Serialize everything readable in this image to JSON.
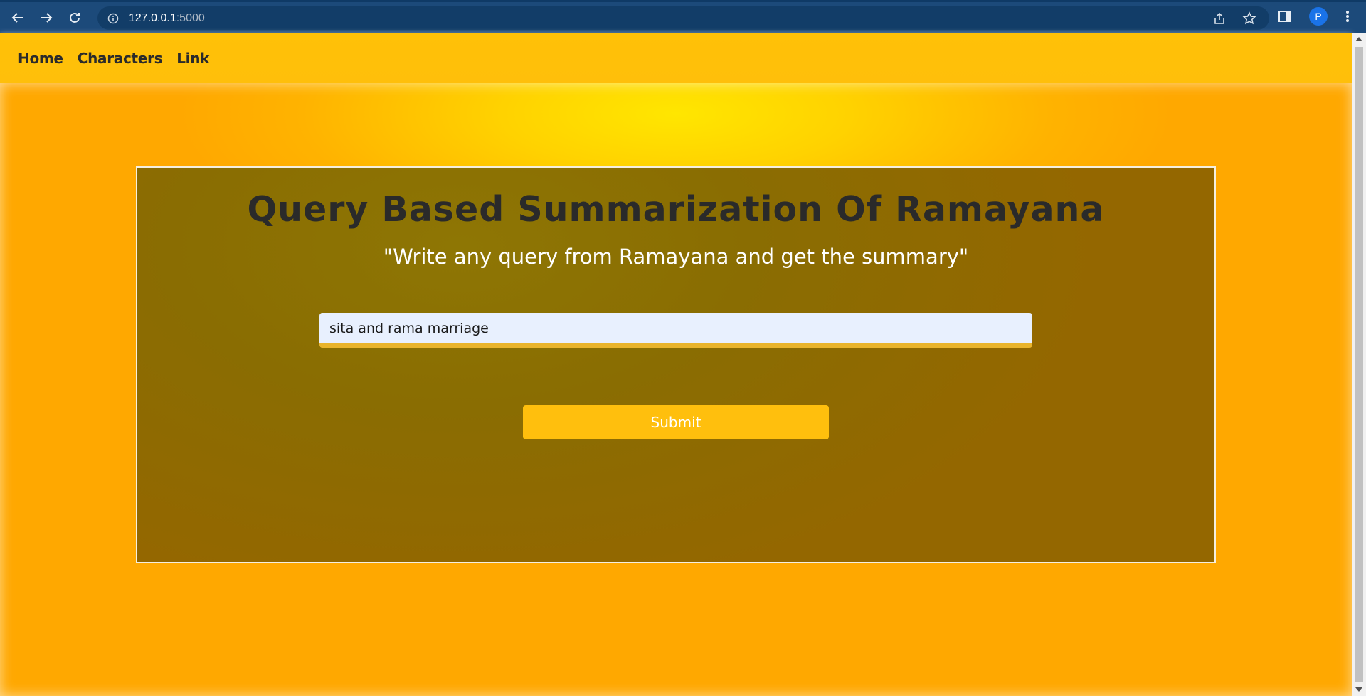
{
  "browser": {
    "url_host": "127.0.0.1",
    "url_port": ":5000",
    "avatar_letter": "P",
    "icons": [
      "back-arrow-icon",
      "forward-arrow-icon",
      "reload-icon",
      "info-icon",
      "share-icon",
      "star-icon",
      "side-panel-icon",
      "kebab-menu-icon"
    ]
  },
  "nav": {
    "home": "Home",
    "characters": "Characters",
    "link": "Link"
  },
  "main": {
    "title": "Query Based Summarization Of Ramayana",
    "subtitle": "\"Write any query from Ramayana and get the summary\"",
    "query_value": "sita and rama marriage",
    "submit_label": "Submit"
  },
  "colors": {
    "browser_bar": "#1c4a7a",
    "nav_bg": "#ffc107",
    "page_bg": "#ffb300",
    "card_bg": "#8a6d02",
    "submit_bg": "#ffbf0d"
  }
}
